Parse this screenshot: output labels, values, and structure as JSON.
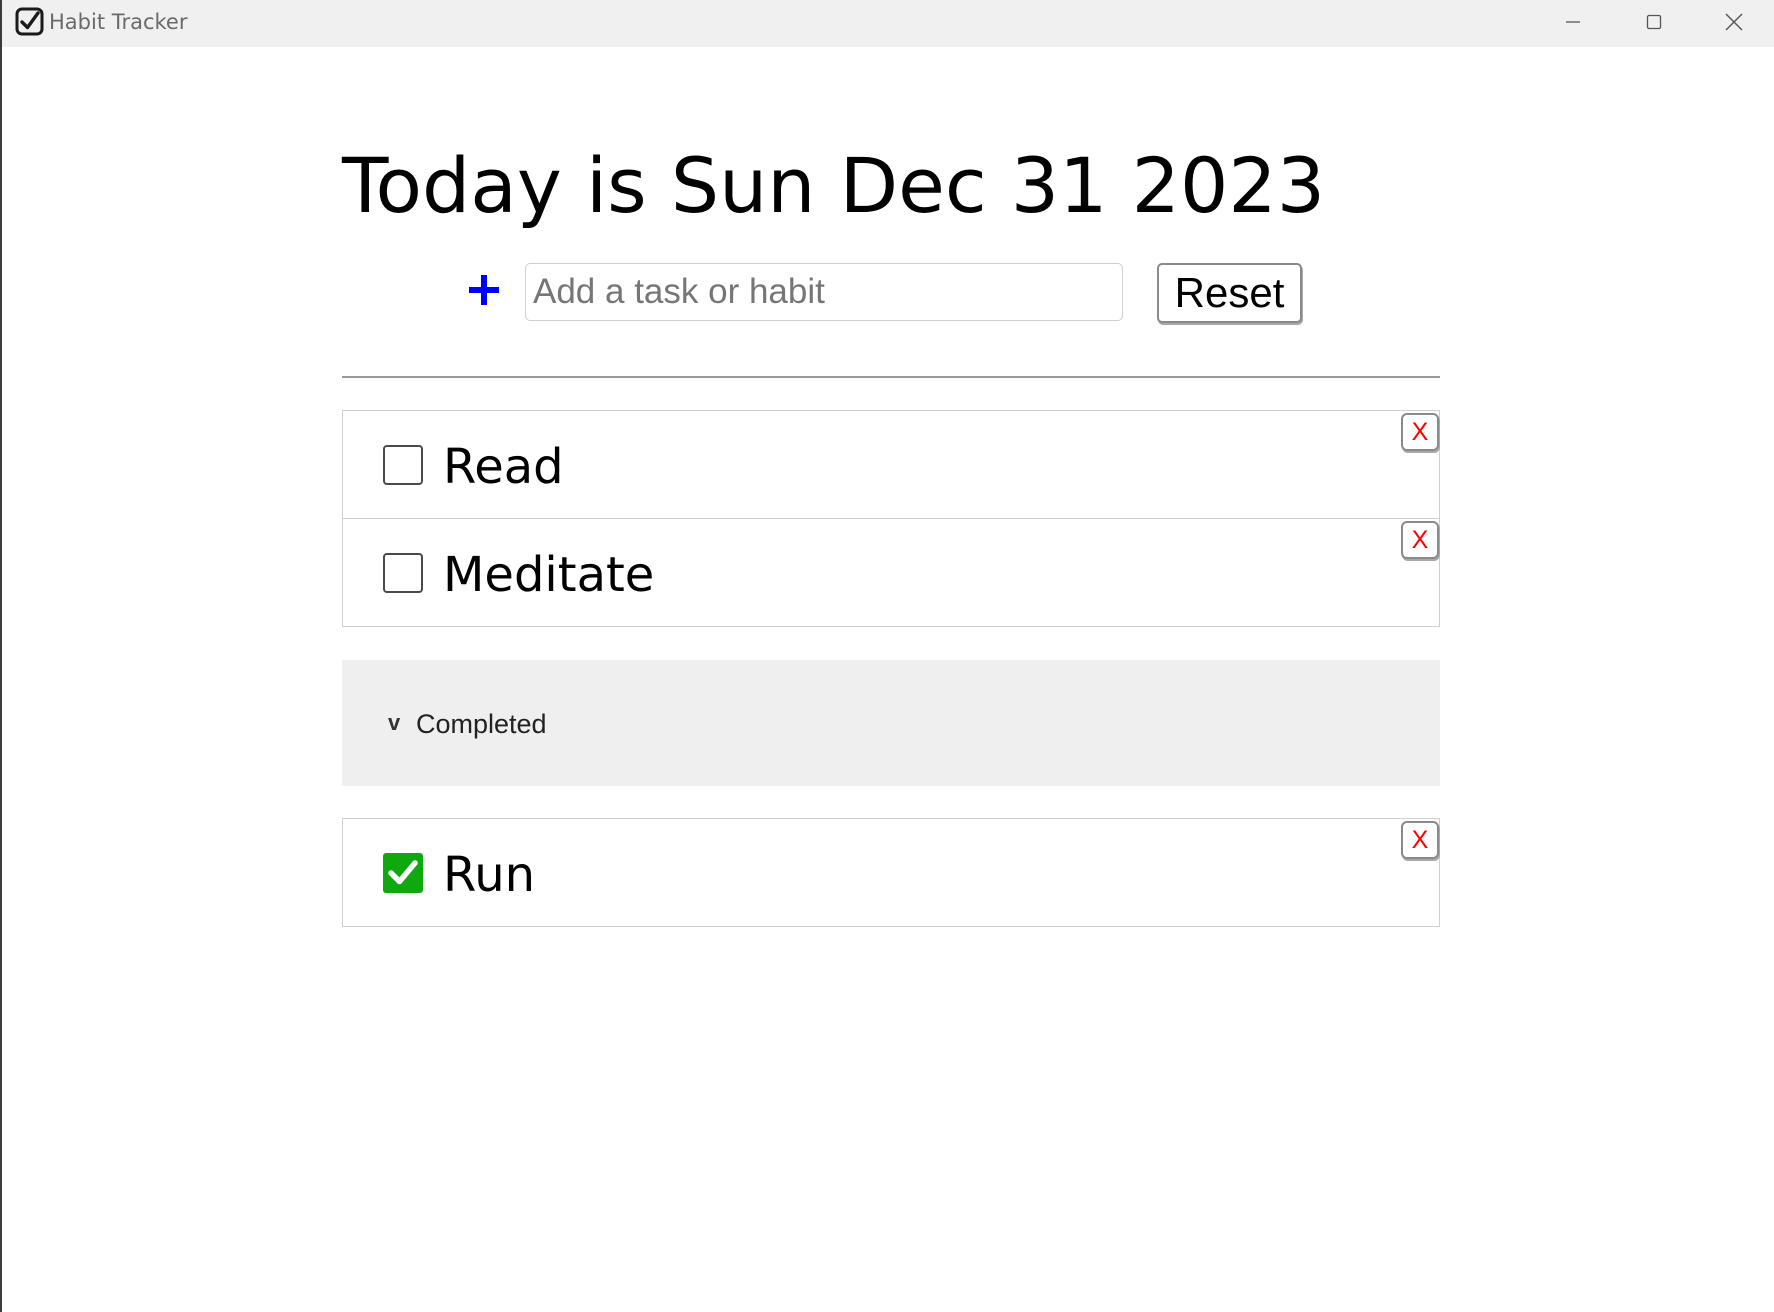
{
  "window": {
    "title": "Habit Tracker",
    "icon": "checkbox-check-icon",
    "controls": [
      "minimize-icon",
      "maximize-icon",
      "close-icon"
    ]
  },
  "header": {
    "title": "Today is Sun Dec 31 2023"
  },
  "add_form": {
    "add_icon": "plus-icon",
    "input_placeholder": "Add a task or habit",
    "input_value": "",
    "reset_label": "Reset"
  },
  "tasks": [
    {
      "label": "Read",
      "checked": false,
      "delete_label": "X"
    },
    {
      "label": "Meditate",
      "checked": false,
      "delete_label": "X"
    }
  ],
  "completed_section": {
    "chevron": "v",
    "label": "Completed",
    "expanded": true
  },
  "completed_tasks": [
    {
      "label": "Run",
      "checked": true,
      "delete_label": "X"
    }
  ],
  "colors": {
    "add_icon": "#0000ff",
    "checked_box": "#0fa80f",
    "delete_x": "#ff0000",
    "completed_bg": "#efefef"
  }
}
